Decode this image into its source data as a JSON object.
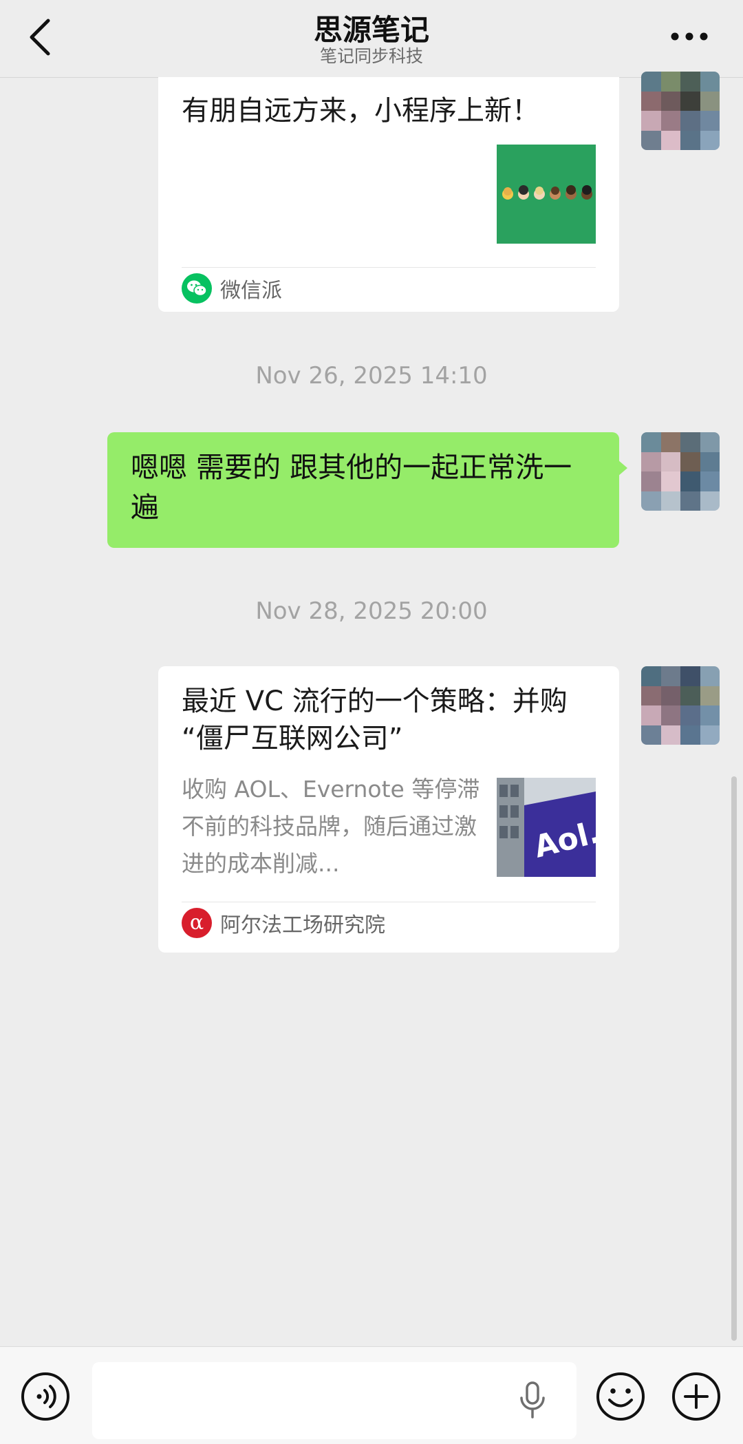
{
  "header": {
    "title": "思源笔记",
    "subtitle": "笔记同步科技"
  },
  "messages": {
    "card1": {
      "title": "有朋自远方来，小程序上新！",
      "source": "微信派"
    },
    "timestamp1": "Nov 26, 2025 14:10",
    "text1": "嗯嗯 需要的 跟其他的一起正常洗一遍",
    "timestamp2": "Nov 28, 2025 20:00",
    "card2": {
      "title": "最近 VC 流行的一个策略：并购 “僵尸互联网公司”",
      "desc": "收购 AOL、Evernote 等停滞不前的科技品牌，随后通过激进的成本削减...",
      "thumb_text": "Aol.",
      "source": "阿尔法工场研究院",
      "source_icon_glyph": "α"
    }
  },
  "colors": {
    "background": "#ededed",
    "bubble_green": "#95ec69",
    "wechat_green": "#07c160",
    "alpha_red": "#d81e2c"
  },
  "icons": [
    "back-icon",
    "more-icon",
    "voice-icon",
    "microphone-icon",
    "emoji-icon",
    "plus-icon",
    "wechat-icon"
  ]
}
